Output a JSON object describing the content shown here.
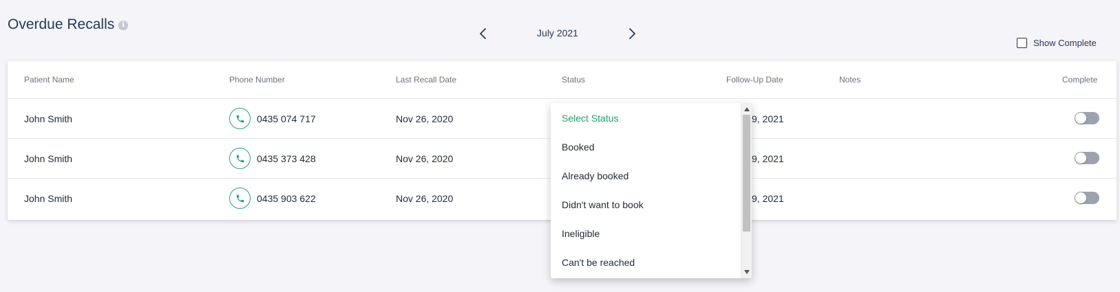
{
  "header": {
    "title": "Overdue Recalls",
    "info_icon": "i"
  },
  "month_nav": {
    "label": "July 2021",
    "prev_icon": "chevron-left-icon",
    "next_icon": "chevron-right-icon"
  },
  "show_complete": {
    "label": "Show Complete",
    "checked": false
  },
  "table": {
    "columns": {
      "patient_name": "Patient Name",
      "phone_number": "Phone Number",
      "last_recall_date": "Last Recall Date",
      "status": "Status",
      "follow_up_date": "Follow-Up Date",
      "notes": "Notes",
      "complete": "Complete"
    },
    "rows": [
      {
        "patient_name": "John Smith",
        "phone": "0435 074 717",
        "last_recall": "Nov 26, 2020",
        "follow_up_visible": "9, 2021",
        "complete": false
      },
      {
        "patient_name": "John Smith",
        "phone": "0435 373 428",
        "last_recall": "Nov 26, 2020",
        "follow_up_visible": "9, 2021",
        "complete": false
      },
      {
        "patient_name": "John Smith",
        "phone": "0435 903 622",
        "last_recall": "Nov 26, 2020",
        "follow_up_visible": "9, 2021",
        "complete": false
      }
    ]
  },
  "status_dropdown": {
    "options": [
      {
        "label": "Select Status",
        "selected": true
      },
      {
        "label": "Booked",
        "selected": false
      },
      {
        "label": "Already booked",
        "selected": false
      },
      {
        "label": "Didn't want to book",
        "selected": false
      },
      {
        "label": "Ineligible",
        "selected": false
      },
      {
        "label": "Can't be reached",
        "selected": false
      }
    ]
  },
  "colors": {
    "accent": "#2a9d8f",
    "selected_option": "#2a9d6f",
    "title": "#253858",
    "background": "#f4f4f9"
  }
}
